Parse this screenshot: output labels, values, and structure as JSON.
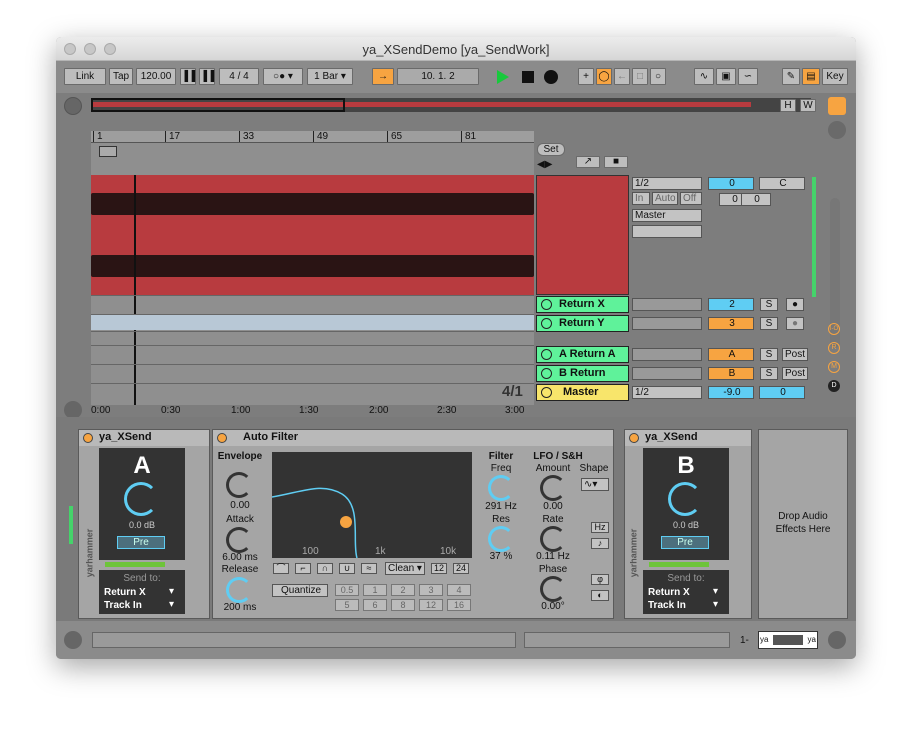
{
  "window": {
    "title": "ya_XSendDemo  [ya_SendWork]"
  },
  "transport": {
    "link": "Link",
    "tap": "Tap",
    "tempo": "120.00",
    "sig_num": "4",
    "sig_sep": "/",
    "sig_den": "4",
    "quant": "1 Bar",
    "position": "10.  1.  2",
    "key": "Key",
    "follow_icon": "follow-arrow-icon"
  },
  "arrangement": {
    "ruler": [
      "1",
      "17",
      "33",
      "49",
      "65",
      "81"
    ],
    "time": [
      "0:00",
      "0:30",
      "1:00",
      "1:30",
      "2:00",
      "2:30",
      "3:00"
    ],
    "set_label": "Set",
    "loop_len": "4/1",
    "hw": [
      "H",
      "W"
    ]
  },
  "tracks": {
    "main": {
      "input": "1/2",
      "in": "In",
      "auto": "Auto",
      "off": "Off",
      "output": "Master",
      "vol": "0",
      "pan": "C",
      "v1": "0",
      "v2": "0"
    },
    "return_x": {
      "name": "Return X",
      "num": "2",
      "solo": "S"
    },
    "return_y": {
      "name": "Return Y",
      "num": "3",
      "solo": "S"
    },
    "return_a": {
      "name": "A Return A",
      "letter": "A",
      "solo": "S",
      "post": "Post"
    },
    "return_b": {
      "name": "B Return",
      "letter": "B",
      "solo": "S",
      "post": "Post"
    },
    "master": {
      "name": "Master",
      "output": "1/2",
      "vol": "-9.0",
      "pan": "0"
    }
  },
  "side_buttons": [
    "I-O",
    "R",
    "M",
    "D"
  ],
  "devices": {
    "xsend_a": {
      "title": "ya_XSend",
      "letter": "A",
      "db": "0.0 dB",
      "pre": "Pre",
      "send_to": "Send to:",
      "dest1": "Return X",
      "dest2": "Track In",
      "brand": "yarhammer"
    },
    "autofilter": {
      "title": "Auto Filter",
      "envelope": "Envelope",
      "env_val": "0.00",
      "attack": "Attack",
      "attack_val": "6.00 ms",
      "release": "Release",
      "release_val": "200 ms",
      "filter": "Filter",
      "freq": "Freq",
      "freq_val": "291 Hz",
      "res": "Res",
      "res_val": "37 %",
      "lfo": "LFO / S&H",
      "amount": "Amount",
      "amount_val": "0.00",
      "shape": "Shape",
      "rate": "Rate",
      "rate_val": "0.11 Hz",
      "phase": "Phase",
      "phase_val": "0.00°",
      "hz": "Hz",
      "graph_labels": [
        "100",
        "1k",
        "10k"
      ],
      "mode": "Clean",
      "slope12": "12",
      "slope24": "24",
      "quantize": "Quantize",
      "quant_vals": [
        "0.5",
        "1",
        "2",
        "3",
        "4",
        "5",
        "6",
        "8",
        "12",
        "16"
      ]
    },
    "xsend_b": {
      "title": "ya_XSend",
      "letter": "B",
      "db": "0.0 dB",
      "pre": "Pre",
      "send_to": "Send to:",
      "dest1": "Return X",
      "dest2": "Track In",
      "brand": "yarhammer"
    },
    "drop": {
      "text": "Drop Audio Effects Here"
    }
  },
  "status": {
    "track_label": "1-",
    "mini_left": "ya",
    "mini_right": "ya"
  },
  "colors": {
    "clip_red": "#b83b3f",
    "return_green": "#5ff29a",
    "master_yellow": "#f8e56b",
    "accent_orange": "#f7a441",
    "blue": "#5fcdf3"
  }
}
